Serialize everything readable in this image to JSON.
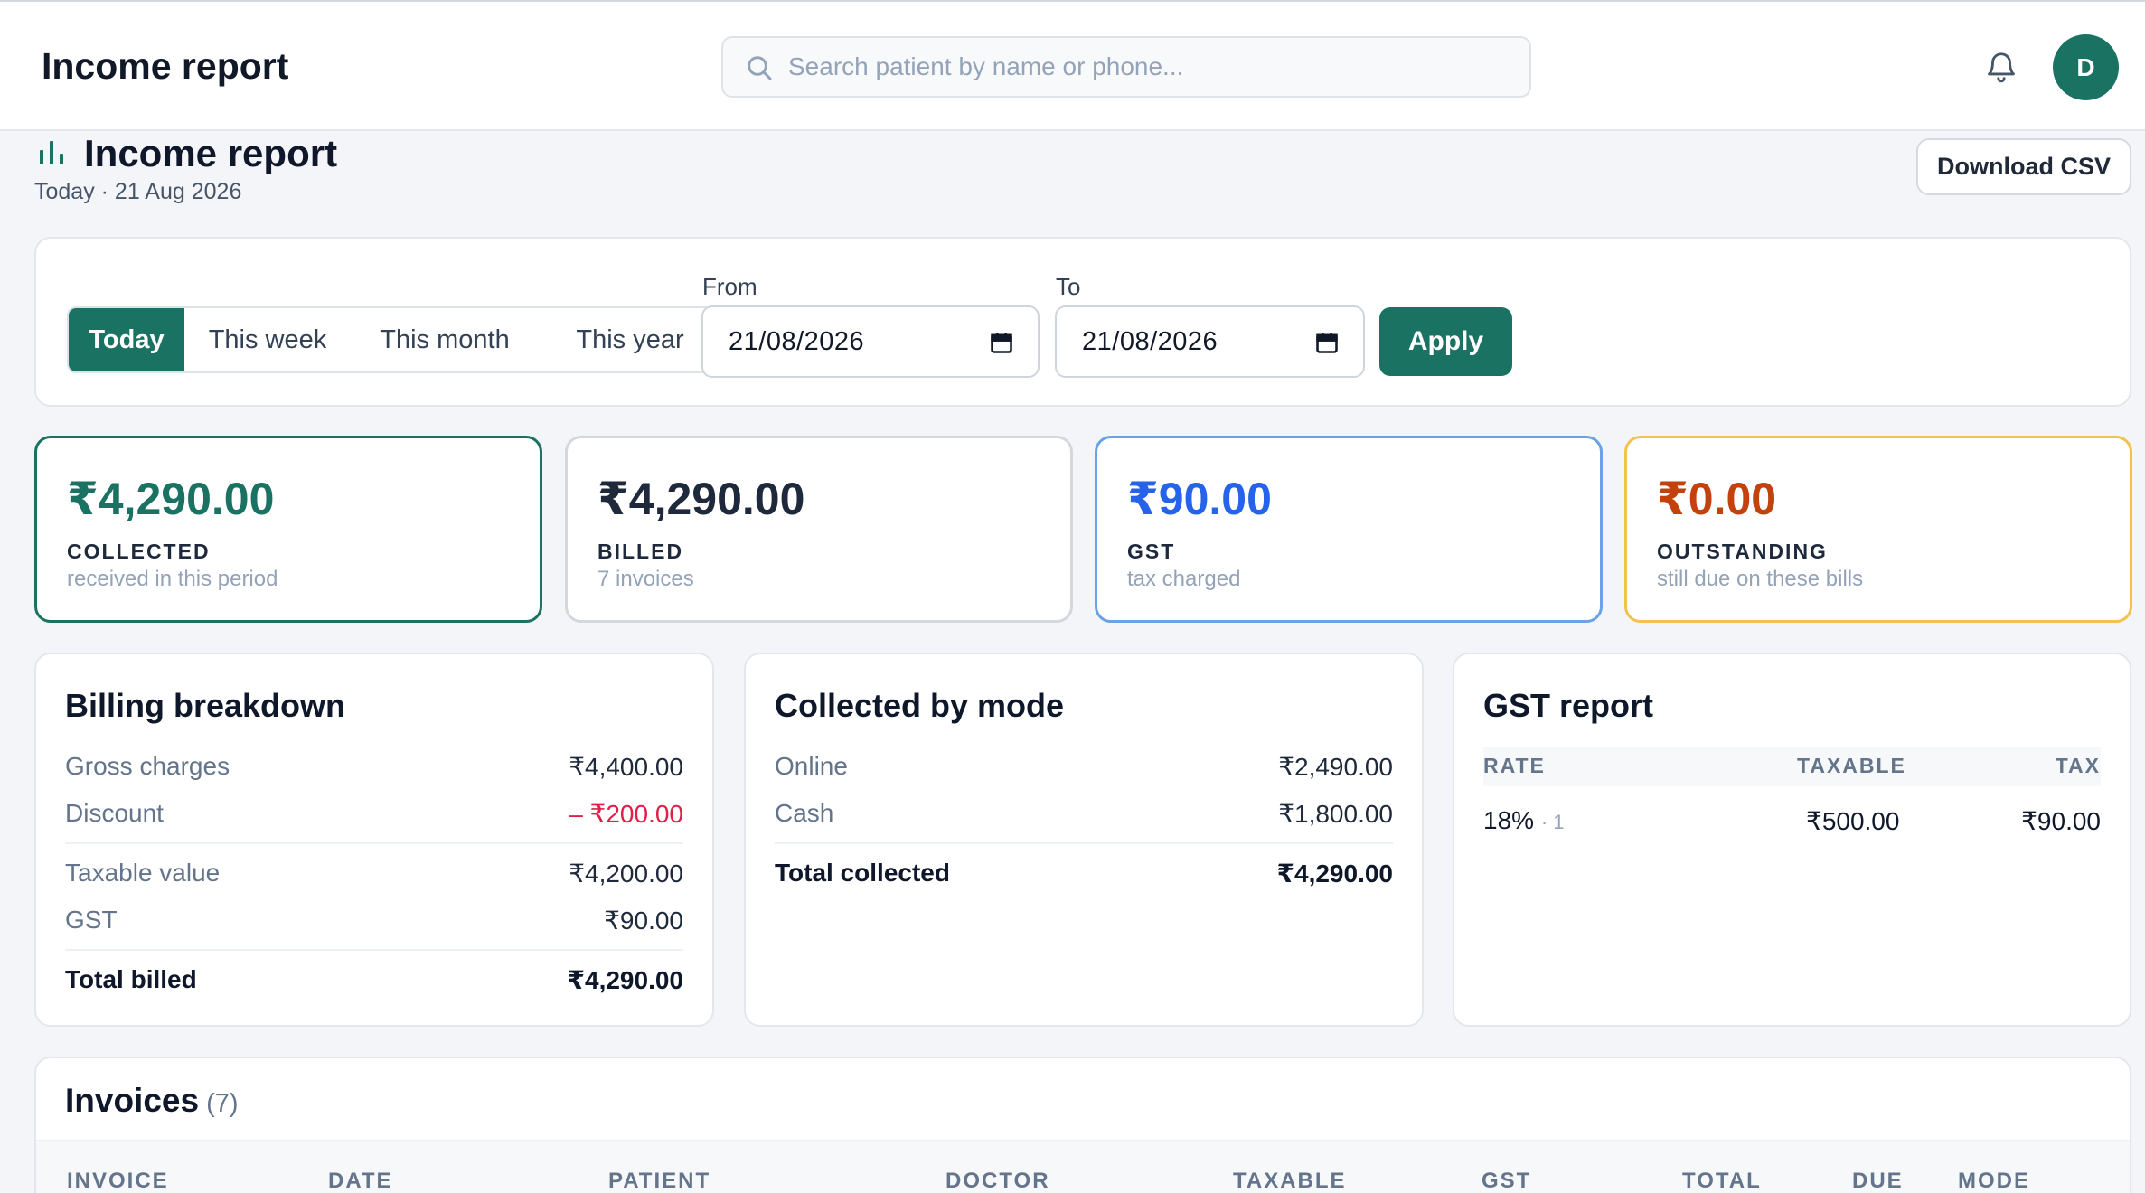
{
  "topbar": {
    "title": "Income report",
    "search_placeholder": "Search patient by name or phone...",
    "avatar_initial": "D"
  },
  "header": {
    "title": "Income report",
    "subtitle": "Today · 21 Aug 2026",
    "download_label": "Download CSV"
  },
  "filter": {
    "periods": [
      "Today",
      "This week",
      "This month",
      "This year"
    ],
    "active_period": "Today",
    "from_label": "From",
    "from_value": "21/08/2026",
    "to_label": "To",
    "to_value": "21/08/2026",
    "apply_label": "Apply"
  },
  "stats": [
    {
      "amount": "₹4,290.00",
      "label": "COLLECTED",
      "desc": "received in this period",
      "color": "#1a7263",
      "border": "#1a7263"
    },
    {
      "amount": "₹4,290.00",
      "label": "BILLED",
      "desc": "7 invoices",
      "color": "#1e293b",
      "border": "#d3d8df"
    },
    {
      "amount": "₹90.00",
      "label": "GST",
      "desc": "tax charged",
      "color": "#2563eb",
      "border": "#6aa2e8"
    },
    {
      "amount": "₹0.00",
      "label": "OUTSTANDING",
      "desc": "still due on these bills",
      "color": "#c2410c",
      "border": "#f2c14e"
    }
  ],
  "billing": {
    "title": "Billing breakdown",
    "gross_label": "Gross charges",
    "gross_value": "₹4,400.00",
    "discount_label": "Discount",
    "discount_value": "– ₹200.00",
    "taxable_label": "Taxable value",
    "taxable_value": "₹4,200.00",
    "gst_label": "GST",
    "gst_value": "₹90.00",
    "total_label": "Total billed",
    "total_value": "₹4,290.00",
    "discount_color": "#e11d48"
  },
  "collected": {
    "title": "Collected by mode",
    "online_label": "Online",
    "online_value": "₹2,490.00",
    "cash_label": "Cash",
    "cash_value": "₹1,800.00",
    "total_label": "Total collected",
    "total_value": "₹4,290.00"
  },
  "gst_report": {
    "title": "GST report",
    "columns": [
      "RATE",
      "TAXABLE",
      "TAX"
    ],
    "rows": [
      {
        "rate": "18%",
        "count": "· 1",
        "taxable": "₹500.00",
        "tax": "₹90.00"
      }
    ]
  },
  "invoices": {
    "title": "Invoices",
    "count": "(7)",
    "columns": [
      "INVOICE",
      "DATE",
      "PATIENT",
      "DOCTOR",
      "TAXABLE",
      "GST",
      "TOTAL",
      "DUE",
      "MODE"
    ]
  },
  "colors": {
    "accent": "#1a7263",
    "page_bg": "#f3f5f8"
  }
}
